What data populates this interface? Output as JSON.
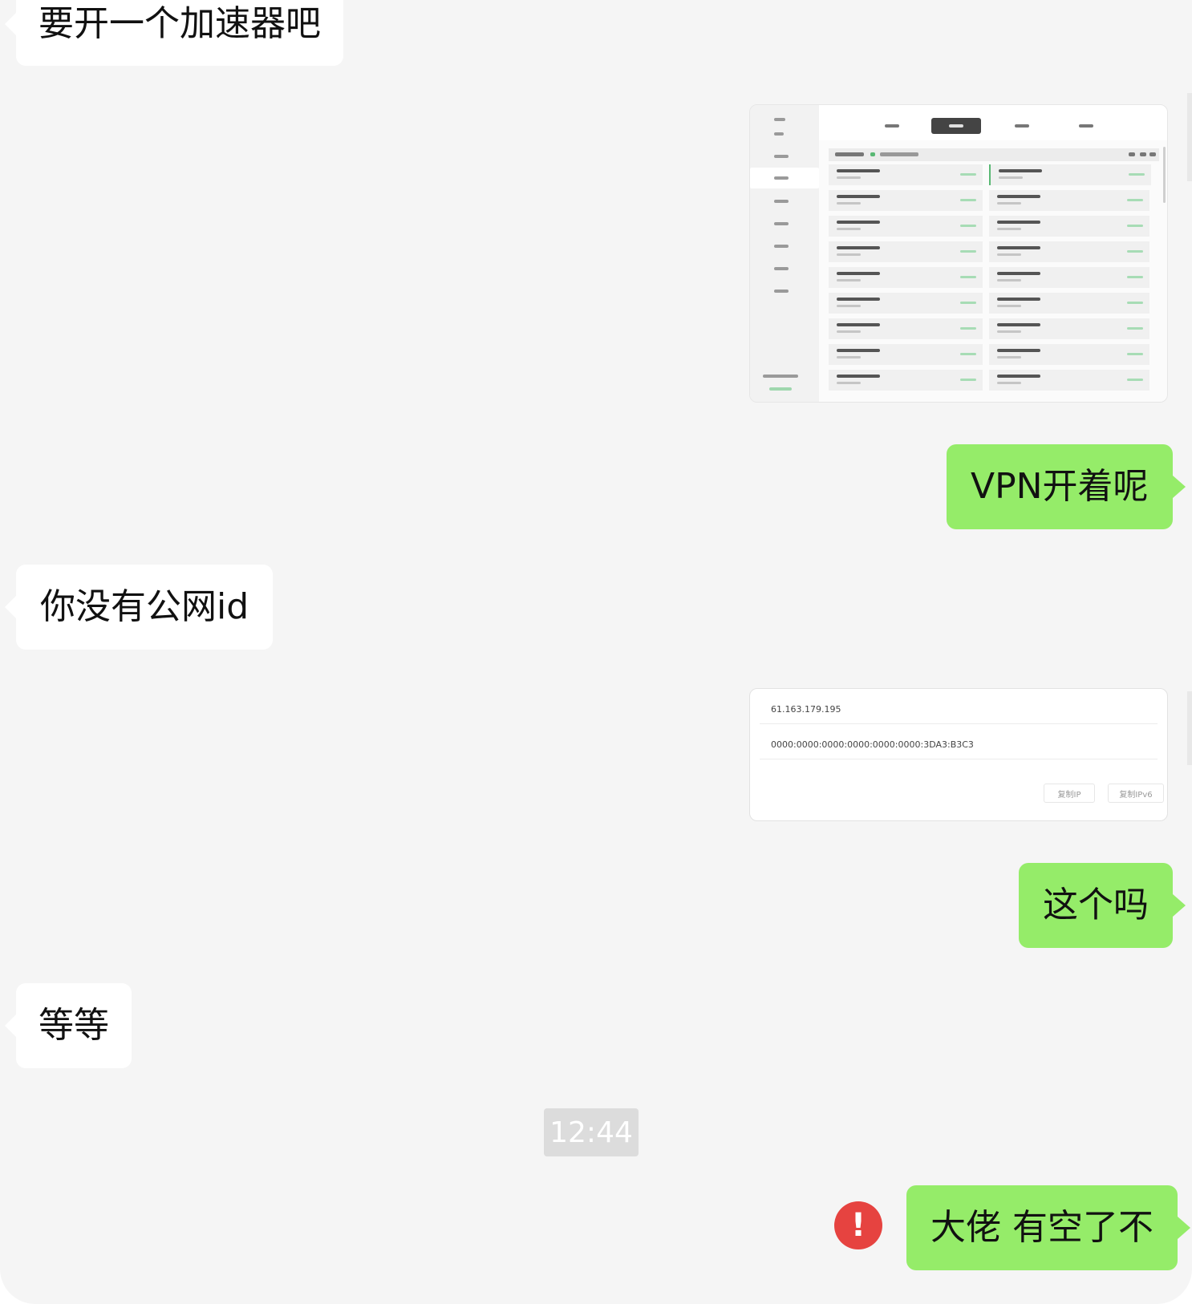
{
  "messages": [
    {
      "side": "in",
      "type": "text",
      "text": "要开一个加速器吧"
    },
    {
      "side": "out",
      "type": "image",
      "description_icon": "screenshot-thumbnail-server-list"
    },
    {
      "side": "out",
      "type": "text",
      "text": "VPN开着呢"
    },
    {
      "side": "in",
      "type": "text",
      "text": "你没有公网id"
    },
    {
      "side": "out",
      "type": "image",
      "description_icon": "screenshot-thumbnail-ip-info"
    },
    {
      "side": "out",
      "type": "text",
      "text": "这个吗"
    },
    {
      "side": "in",
      "type": "text",
      "text": "等等"
    },
    {
      "side": "system",
      "type": "time",
      "text": "12:44"
    },
    {
      "side": "out",
      "type": "text",
      "text": "大佬 有空了不",
      "status": "failed"
    }
  ],
  "ip_card": {
    "ipv4": "61.163.179.195",
    "ipv6": "0000:0000:0000:0000:0000:0000:3DA3:B3C3",
    "copy_ip_label": "复制IP",
    "copy_ipv6_label": "复制IPv6"
  },
  "alert_glyph": "!",
  "colors": {
    "background": "#f5f5f5",
    "incoming_bubble": "#ffffff",
    "outgoing_bubble": "#95ec69",
    "alert": "#e64340",
    "timestamp_bg": "#dcdcdc"
  }
}
